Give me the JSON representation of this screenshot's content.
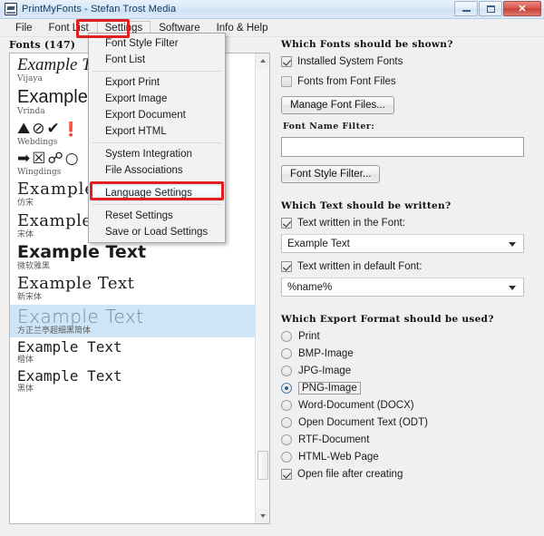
{
  "window": {
    "title": "PrintMyFonts - Stefan Trost Media",
    "app_icon": "printer-icon",
    "controls": {
      "minimize": "minimize-icon",
      "maximize": "maximize-icon",
      "close": "✕"
    }
  },
  "menubar": {
    "items": [
      {
        "label": "File",
        "active": false
      },
      {
        "label": "Font List",
        "active": false
      },
      {
        "label": "Settings",
        "active": true
      },
      {
        "label": "Software",
        "active": false
      },
      {
        "label": "Info & Help",
        "active": false
      }
    ]
  },
  "settings_menu": {
    "groups": [
      [
        {
          "label": "Font Style Filter",
          "hover": false
        },
        {
          "label": "Font List",
          "hover": false
        }
      ],
      [
        {
          "label": "Export Print",
          "hover": false
        },
        {
          "label": "Export Image",
          "hover": false
        },
        {
          "label": "Export Document",
          "hover": false
        },
        {
          "label": "Export HTML",
          "hover": false
        }
      ],
      [
        {
          "label": "System Integration",
          "hover": false
        },
        {
          "label": "File Associations",
          "hover": false
        }
      ],
      [
        {
          "label": "Language Settings",
          "hover": true
        }
      ],
      [
        {
          "label": "Reset Settings",
          "hover": false
        },
        {
          "label": "Save or Load Settings",
          "hover": false
        }
      ]
    ]
  },
  "annotations": {
    "accent_color": "#e02020",
    "boxes": [
      "settings-menu-title",
      "language-settings-item"
    ]
  },
  "font_list": {
    "header": "Fonts  (147)",
    "count": 147,
    "rows": [
      {
        "sample": "Example Text",
        "name": "Vijaya",
        "style": "f-vijaya",
        "selected": false
      },
      {
        "sample": "Example Text",
        "name": "Vrinda",
        "style": "f-vrinda",
        "selected": false
      },
      {
        "sample": "⛰⊘✔❗",
        "name": "Webdings",
        "style": "f-dings",
        "selected": false
      },
      {
        "sample": "➡☒☍○",
        "name": "Wingdings",
        "style": "f-dings",
        "selected": false
      },
      {
        "sample": "Example Text",
        "name": "仿宋",
        "style": "f-fangsong",
        "selected": false
      },
      {
        "sample": "Example Text",
        "name": "宋体",
        "style": "f-songti",
        "selected": false
      },
      {
        "sample": "Example Text",
        "name": "微软雅黑",
        "style": "f-yahei",
        "selected": false
      },
      {
        "sample": "Example Text",
        "name": "新宋体",
        "style": "f-xinsong",
        "selected": false
      },
      {
        "sample": "Example Text",
        "name": "方正兰亭超细黑简体",
        "style": "f-lanting",
        "selected": true
      },
      {
        "sample": "Example Text",
        "name": "楷体",
        "style": "f-kaiti",
        "selected": false
      },
      {
        "sample": "Example Text",
        "name": "黑体",
        "style": "f-heiti",
        "selected": false
      }
    ]
  },
  "options": {
    "fonts_section": {
      "heading": "Which Fonts should be shown?",
      "installed_system_fonts": {
        "label": "Installed System Fonts",
        "checked": true
      },
      "fonts_from_font_files": {
        "label": "Fonts from Font Files",
        "checked": false
      },
      "manage_button": "Manage Font Files...",
      "name_filter_label": "Font Name Filter:",
      "name_filter_value": "",
      "name_filter_placeholder": "",
      "style_filter_button": "Font Style Filter..."
    },
    "text_section": {
      "heading": "Which Text should be written?",
      "text_in_font": {
        "label": "Text written in the Font:",
        "checked": true
      },
      "text_in_font_value": "Example Text",
      "text_in_default": {
        "label": "Text written in default Font:",
        "checked": true
      },
      "text_in_default_value": "%name%"
    },
    "export_section": {
      "heading": "Which Export Format should be used?",
      "formats": [
        {
          "label": "Print",
          "selected": false
        },
        {
          "label": "BMP-Image",
          "selected": false
        },
        {
          "label": "JPG-Image",
          "selected": false
        },
        {
          "label": "PNG-Image",
          "selected": true
        },
        {
          "label": "Word-Document (DOCX)",
          "selected": false
        },
        {
          "label": "Open Document Text (ODT)",
          "selected": false
        },
        {
          "label": "RTF-Document",
          "selected": false
        },
        {
          "label": "HTML-Web Page",
          "selected": false
        }
      ],
      "open_after_creating": {
        "label": "Open file after creating",
        "checked": true
      }
    }
  },
  "scrollbar": {
    "up_icon": "triangle-up-icon",
    "down_icon": "triangle-down-icon"
  }
}
